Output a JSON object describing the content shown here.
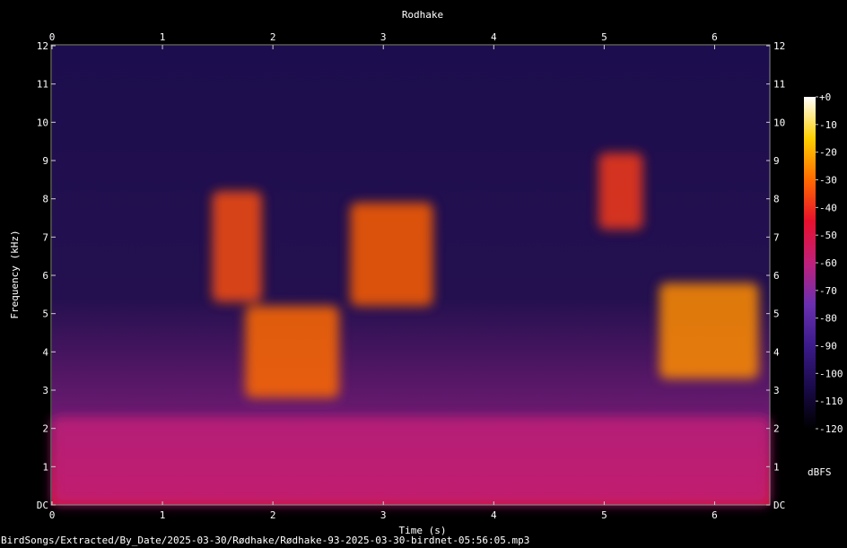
{
  "chart_data": {
    "type": "heatmap",
    "title": "Rodhake",
    "xlabel": "Time (s)",
    "ylabel": "Frequency (kHz)",
    "xlim": [
      0,
      6.5
    ],
    "ylim": [
      0,
      12
    ],
    "x_ticks": [
      "0",
      "1",
      "2",
      "3",
      "4",
      "5",
      "6"
    ],
    "y_ticks": [
      "DC",
      "1",
      "2",
      "3",
      "4",
      "5",
      "6",
      "7",
      "8",
      "9",
      "10",
      "11",
      "12"
    ],
    "colorbar": {
      "label": "dBFS",
      "range": [
        -120,
        0
      ],
      "ticks": [
        "+0",
        "-10",
        "-20",
        "-30",
        "-40",
        "-50",
        "-60",
        "-70",
        "-80",
        "-90",
        "-100",
        "-110",
        "-120"
      ]
    },
    "colormap": [
      "#000000",
      "#1a0a4a",
      "#3b1a8a",
      "#6a2fb0",
      "#c0207a",
      "#e8102c",
      "#ff6a00",
      "#ffd000",
      "#ffffff"
    ],
    "energy_regions": [
      {
        "t": [
          1.45,
          1.9
        ],
        "f": [
          5.3,
          8.2
        ],
        "level_dbfs": -35
      },
      {
        "t": [
          1.75,
          2.6
        ],
        "f": [
          2.8,
          5.2
        ],
        "level_dbfs": -30
      },
      {
        "t": [
          2.7,
          3.45
        ],
        "f": [
          5.2,
          7.9
        ],
        "level_dbfs": -32
      },
      {
        "t": [
          4.95,
          5.35
        ],
        "f": [
          7.2,
          9.2
        ],
        "level_dbfs": -38
      },
      {
        "t": [
          5.5,
          6.4
        ],
        "f": [
          3.3,
          5.8
        ],
        "level_dbfs": -25
      },
      {
        "t": [
          0.0,
          6.5
        ],
        "f": [
          0.0,
          2.3
        ],
        "level_dbfs": -60
      }
    ]
  },
  "footer": {
    "path": "BirdSongs/Extracted/By_Date/2025-03-30/Rødhake/Rødhake-93-2025-03-30-birdnet-05:56:05.mp3"
  }
}
